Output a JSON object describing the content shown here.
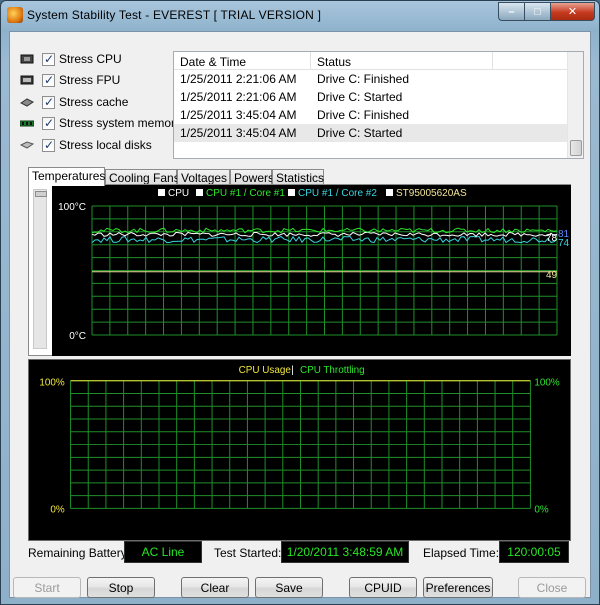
{
  "window": {
    "title": "System Stability Test - EVEREST  [ TRIAL VERSION ]",
    "min_glyph": "–",
    "max_glyph": "□",
    "close_glyph": "✕"
  },
  "stress_options": [
    {
      "label": "Stress CPU",
      "icon": "cpu-chip-icon",
      "checked": true
    },
    {
      "label": "Stress FPU",
      "icon": "fpu-chip-icon",
      "checked": true
    },
    {
      "label": "Stress cache",
      "icon": "cache-icon",
      "checked": true
    },
    {
      "label": "Stress system memory",
      "icon": "memory-module-icon",
      "checked": true
    },
    {
      "label": "Stress local disks",
      "icon": "hard-disk-icon",
      "checked": true
    }
  ],
  "log": {
    "columns": [
      "Date & Time",
      "Status"
    ],
    "rows": [
      {
        "time": "1/25/2011 2:21:06 AM",
        "status": "Drive C: Finished"
      },
      {
        "time": "1/25/2011 2:21:06 AM",
        "status": "Drive C: Started"
      },
      {
        "time": "1/25/2011 3:45:04 AM",
        "status": "Drive C: Finished"
      },
      {
        "time": "1/25/2011 3:45:04 AM",
        "status": "Drive C: Started"
      }
    ]
  },
  "tabs": [
    {
      "label": "Temperatures",
      "active": true
    },
    {
      "label": "Cooling Fans",
      "active": false
    },
    {
      "label": "Voltages",
      "active": false
    },
    {
      "label": "Powers",
      "active": false
    },
    {
      "label": "Statistics",
      "active": false
    }
  ],
  "temperature_graph": {
    "legend": [
      {
        "label": "CPU",
        "color": "#ffffff",
        "checked": true
      },
      {
        "label": "CPU #1 / Core #1",
        "color": "#2de62d",
        "checked": true
      },
      {
        "label": "CPU #1 / Core #2",
        "color": "#3ad6e0",
        "checked": true
      },
      {
        "label": "ST95005620AS",
        "color": "#f3e49a",
        "checked": true
      }
    ],
    "y_top_label": "100°C",
    "y_bottom_label": "0°C",
    "end_labels": [
      {
        "text": "81",
        "color": "#5b88ff"
      },
      {
        "text": "78",
        "color": "#ffffff"
      },
      {
        "text": "74",
        "color": "#3ad6e0"
      },
      {
        "text": "49",
        "color": "#f3e49a"
      }
    ],
    "current_values": {
      "CPU": 78,
      "CPU #1 / Core #1": 81,
      "CPU #1 / Core #2": 74,
      "ST95005620AS": 49
    },
    "y_range": [
      0,
      100
    ]
  },
  "cpu_graph": {
    "legend_left": "CPU Usage",
    "legend_sep": "|",
    "legend_right": "CPU Throttling",
    "left_top": "100%",
    "left_bottom": "0%",
    "right_top": "100%",
    "right_bottom": "0%",
    "colors": {
      "usage": "#f1e83a",
      "throttling": "#2de62d",
      "grid": "#1f8f2a"
    }
  },
  "status": {
    "battery_label": "Remaining Battery:",
    "battery_value": "AC Line",
    "started_label": "Test Started:",
    "started_value": "1/20/2011 3:48:59 AM",
    "elapsed_label": "Elapsed Time:",
    "elapsed_value": "120:00:05"
  },
  "buttons": {
    "start": "Start",
    "stop": "Stop",
    "clear": "Clear",
    "save": "Save",
    "cpuid": "CPUID",
    "preferences": "Preferences",
    "close": "Close"
  }
}
